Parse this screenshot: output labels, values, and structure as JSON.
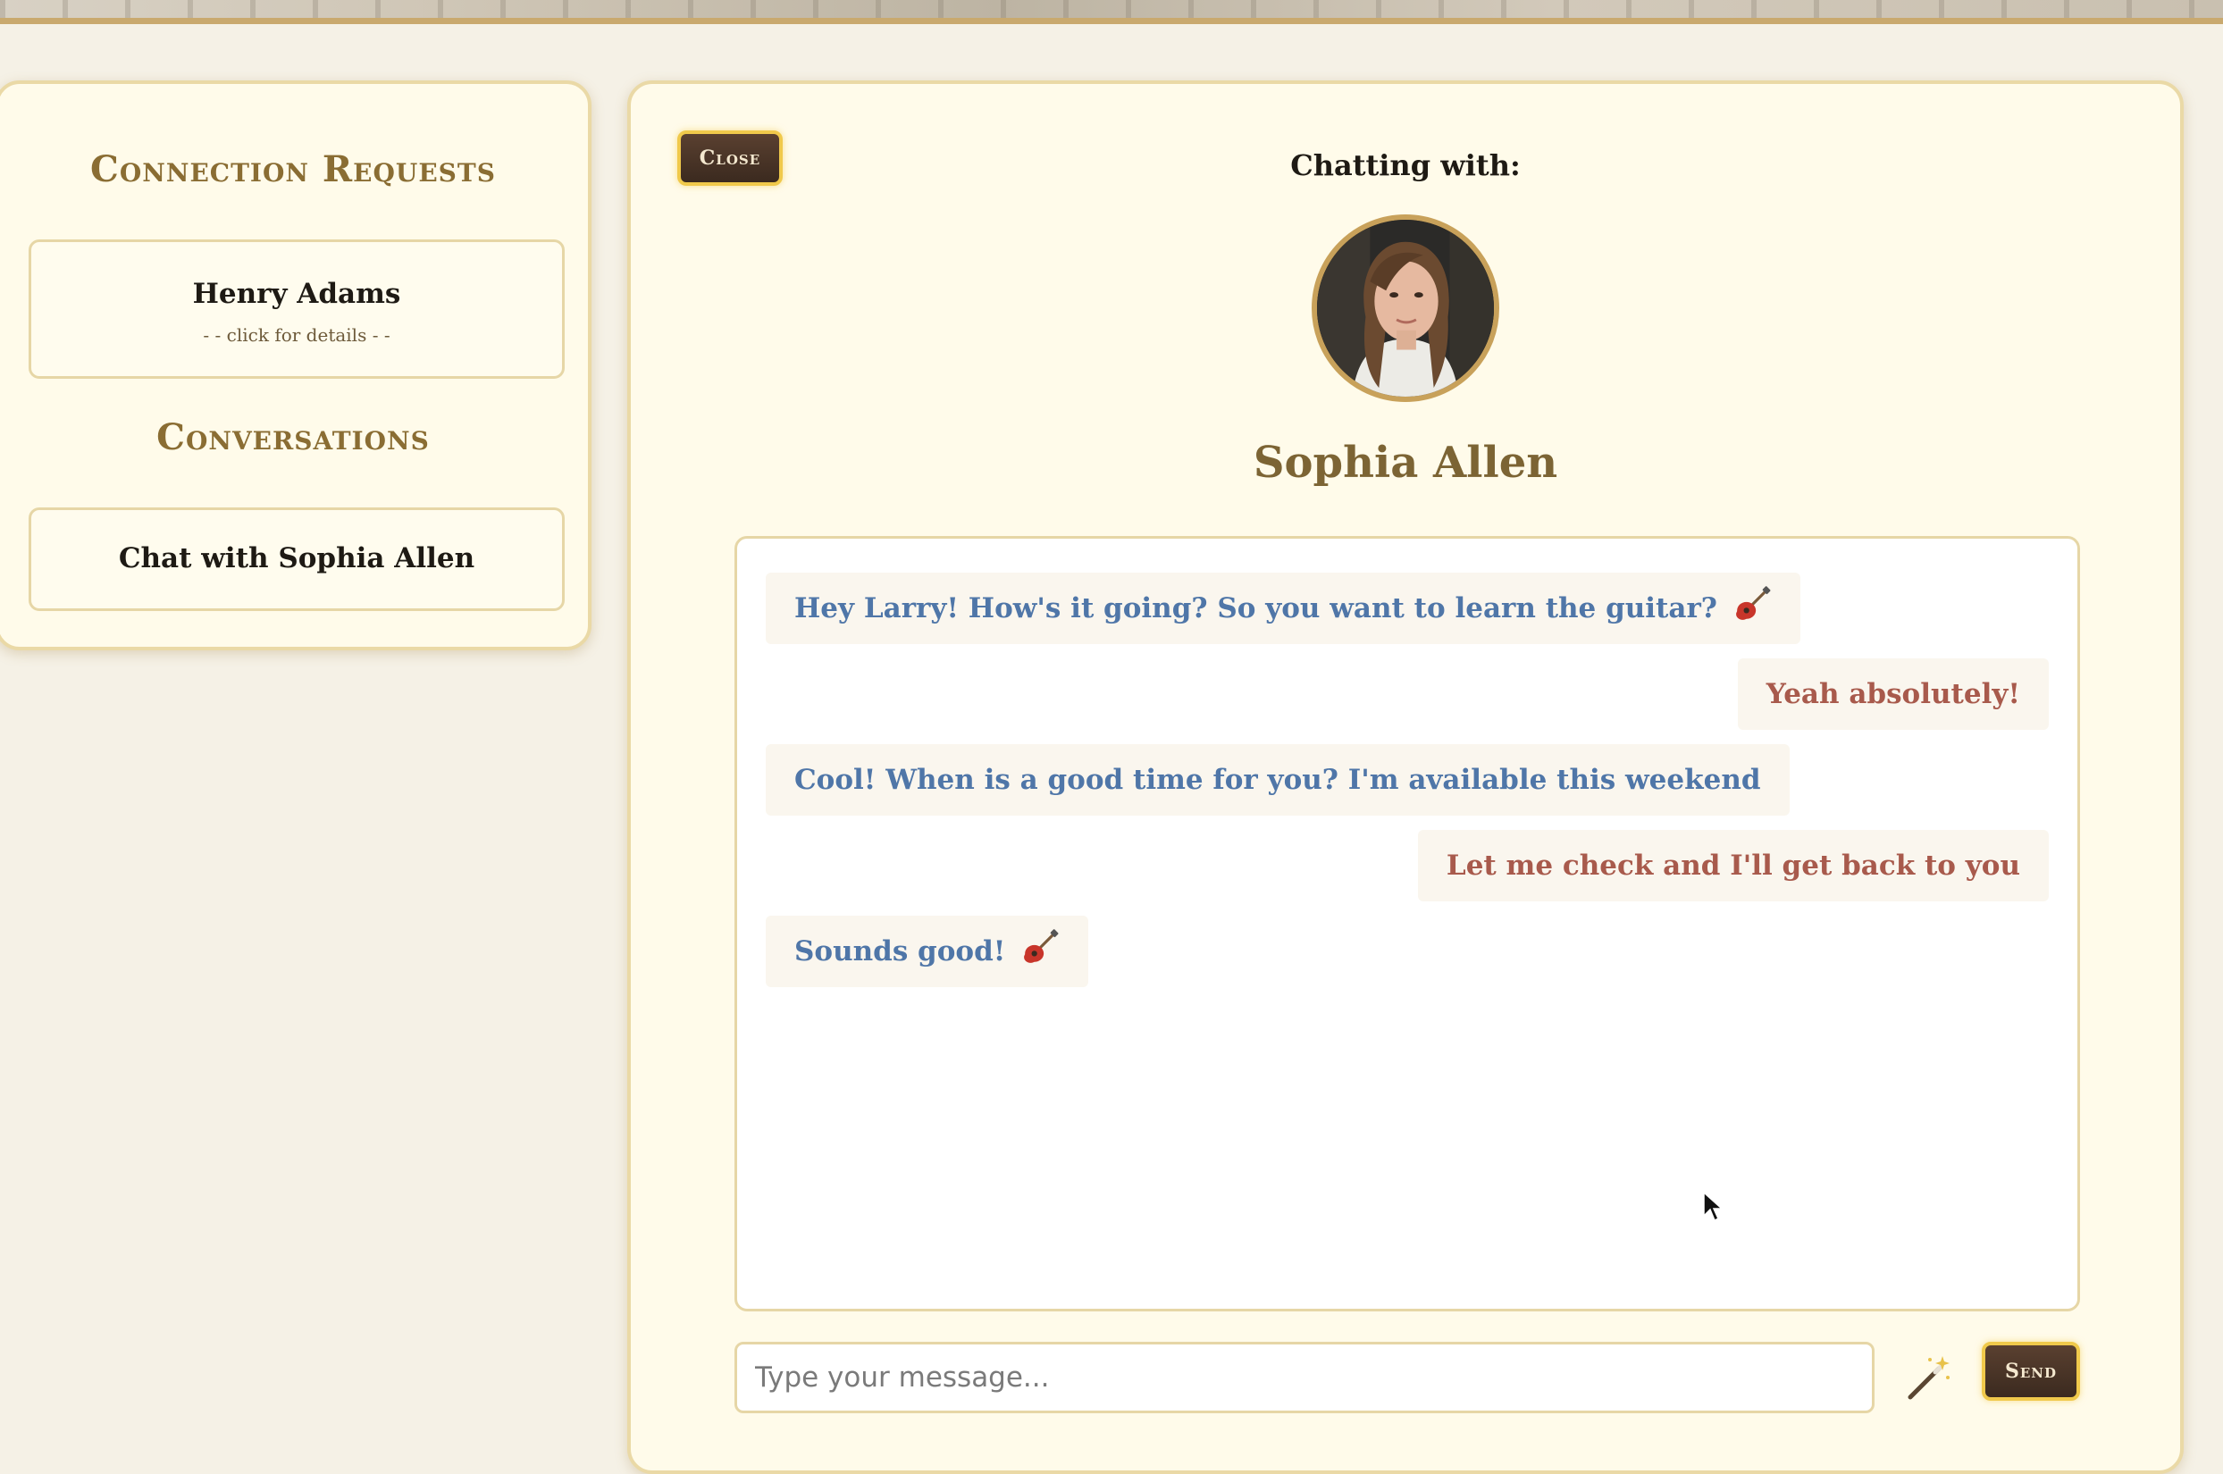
{
  "sidebar": {
    "requests_title": "Connection Requests",
    "request_card": {
      "name": "Henry Adams",
      "hint": "- - click for details - -"
    },
    "conversations_title": "Conversations",
    "conversation_card": {
      "label": "Chat with Sophia Allen"
    }
  },
  "chat": {
    "close_label": "Close",
    "chatting_with_label": "Chatting with:",
    "contact_name": "Sophia Allen",
    "messages": [
      {
        "from": "them",
        "text": "Hey Larry! How's it going? So you want to learn the guitar?",
        "icon": "guitar-icon"
      },
      {
        "from": "me",
        "text": "Yeah absolutely!"
      },
      {
        "from": "them",
        "text": "Cool! When is a good time for you? I'm available this weekend"
      },
      {
        "from": "me",
        "text": "Let me check and I'll get back to you"
      },
      {
        "from": "them",
        "text": "Sounds good!",
        "icon": "guitar-icon"
      }
    ],
    "input": {
      "placeholder": "Type your message...",
      "value": ""
    },
    "send_label": "Send",
    "wand_icon": "magic-wand-icon"
  },
  "colors": {
    "accent_gold": "#f0c94b",
    "button_dark": "#3b2a1f",
    "title_brown": "#8a6d33",
    "their_message": "#4f76a8",
    "my_message": "#a85a4c"
  }
}
